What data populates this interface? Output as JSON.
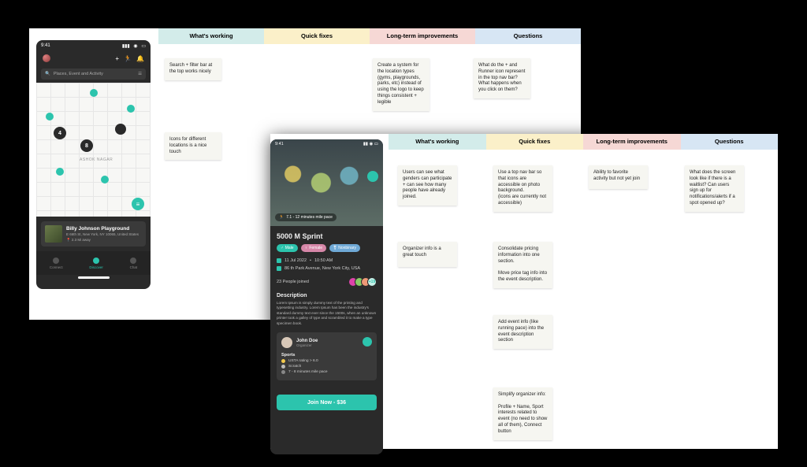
{
  "board1": {
    "headers": [
      "What's working",
      "Quick fixes",
      "Long-term improvements",
      "Questions"
    ],
    "notes": {
      "n1": "Search + filter bar at the top works nicely",
      "n2": "Icons for different locations is a nice touch",
      "n3": "Create a system for the location types (gyms, playgrounds, parks, etc) instead of using the logo to keep things consistent + legible",
      "n4": "What do the + and Runner icon represent in the top nav bar? What happens when you click on them?"
    }
  },
  "board2": {
    "headers": [
      "What's working",
      "Quick fixes",
      "Long-term improvements",
      "Questions"
    ],
    "notes": {
      "n1": "Users can see what genders can participate + can see how many people have already joined.",
      "n2": "Organizer info is a great touch",
      "n3": "Use a top nav bar so that icons are accessible on photo background.\n(icons are currently not accessible)",
      "n4": "Consolidate pricing information into one section.\n\nMove price tag info into the event description.",
      "n5": "Add event info (like running pace) into the event description section",
      "n6": "Simplify organizer info:\n\nProfile + Name, Sport interests related to event (no need to show all of them), Connect button",
      "n7": "Ability to favorite activity but not yet join",
      "n8": "What does the screen look like if there is a waitlist? Can users sign up for notifications/alerts if a spot opened up?"
    }
  },
  "phone_map": {
    "time": "9:41",
    "search_placeholder": "Places, Event and Activity",
    "map_labels": {
      "area": "ASHOK NAGAR"
    },
    "pins": {
      "p1": "4",
      "p2": "8"
    },
    "card": {
      "title": "Billy Johnson Playground",
      "address": "E 66th St, New York, NY 10065, United States",
      "distance": "2.3 Mi away"
    },
    "nav": [
      "Connect",
      "Discover",
      "Chat"
    ]
  },
  "phone_event": {
    "time": "9:41",
    "pace_chip": "7.1 - 12 minutes mile pace",
    "title": "5000 M Sprint",
    "chips": [
      "Male",
      "Female",
      "Nonbinary"
    ],
    "date": "11 Jul 2022",
    "time_s": "10:50 AM",
    "location": "86 th Park Avenue, New York City, USA",
    "joined": "23 People joined",
    "joined_more": "+19",
    "desc_h": "Description",
    "desc": "Lorem Ipsum is simply dummy text of the printing and typesetting industry. Lorem Ipsum has been the industry's standard dummy text ever since the 1500s, when an unknown printer took a galley of type and scrambled it to make a type specimen book.",
    "organizer": {
      "name": "John Doe",
      "sub": "Organizer",
      "sports_h": "Sports",
      "line1": "USTA rating > 6.0",
      "line2": "Scratch",
      "line3": "7 - 8 minutes mile pace"
    },
    "cta": "Join Now - $36"
  }
}
